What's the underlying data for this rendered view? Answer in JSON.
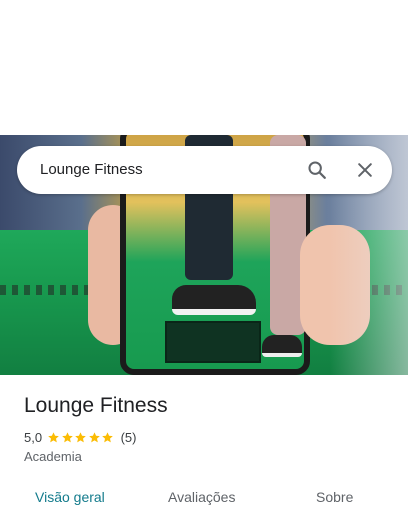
{
  "search": {
    "query": "Lounge Fitness",
    "search_icon": "search-icon",
    "close_icon": "close-icon"
  },
  "place": {
    "name": "Lounge Fitness",
    "rating_value": "5,0",
    "rating_stars": 5,
    "review_count": "(5)",
    "category": "Academia"
  },
  "tabs": [
    {
      "label": "Visão geral",
      "active": true
    },
    {
      "label": "Avaliações",
      "active": false
    },
    {
      "label": "Sobre",
      "active": false
    }
  ],
  "colors": {
    "star": "#fbbc04",
    "active_tab": "#137b8c",
    "inactive_tab": "#5f6368",
    "title": "#202124"
  }
}
